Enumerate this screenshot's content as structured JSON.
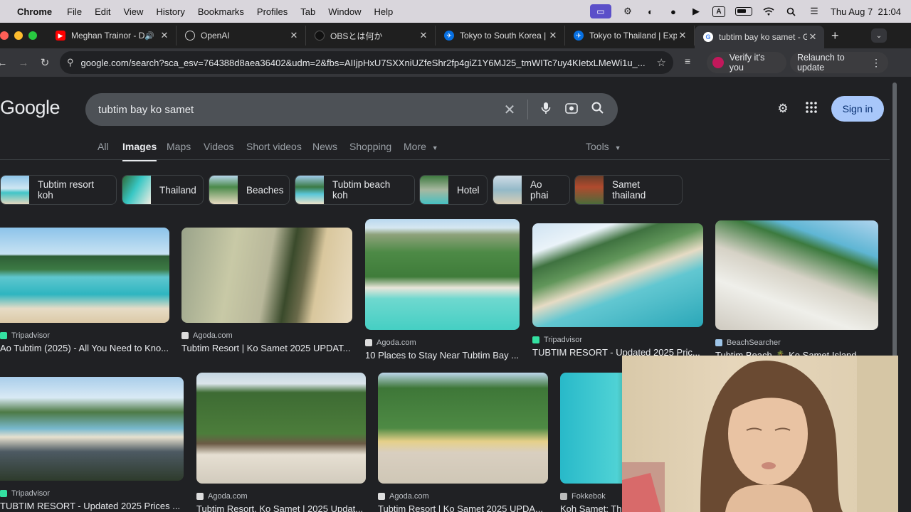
{
  "menubar": {
    "app": "Chrome",
    "items": [
      "File",
      "Edit",
      "View",
      "History",
      "Bookmarks",
      "Profiles",
      "Tab",
      "Window",
      "Help"
    ],
    "datetime": "Thu Aug 7  21:04",
    "input_indicator": "A"
  },
  "tabs": [
    {
      "title": "Meghan Trainor - De",
      "favicon": "youtube-icon",
      "color": "#ff0000",
      "has_speaker": true
    },
    {
      "title": "OpenAI",
      "favicon": "openai-icon",
      "color": "#444444"
    },
    {
      "title": "OBSとは何か",
      "favicon": "chatgpt-icon",
      "color": "#111111"
    },
    {
      "title": "Tokyo to South Korea | E",
      "favicon": "skyscanner-icon",
      "color": "#0770e3"
    },
    {
      "title": "Tokyo to Thailand | Expl",
      "favicon": "skyscanner-icon",
      "color": "#0770e3"
    },
    {
      "title": "tubtim bay ko samet - G",
      "favicon": "google-icon",
      "color": "#ffffff",
      "active": true
    }
  ],
  "toolbar": {
    "url": "google.com/search?sca_esv=764388d8aea36402&udm=2&fbs=AIIjpHxU7SXXniUZfeShr2fp4giZ1Y6MJ25_tmWITc7uy4KIetxLMeWi1u_...",
    "verify": "Verify it's you",
    "relaunch": "Relaunch to update"
  },
  "google": {
    "logo": "Google",
    "query": "tubtim bay ko samet",
    "signin": "Sign in",
    "nav": [
      "All",
      "Images",
      "Maps",
      "Videos",
      "Short videos",
      "News",
      "Shopping",
      "More"
    ],
    "tools": "Tools"
  },
  "chips": [
    "Tubtim resort koh",
    "Thailand",
    "Beaches",
    "Tubtim beach koh",
    "Hotel",
    "Ao phai",
    "Samet thailand"
  ],
  "results_row1": [
    {
      "source": "Tripadvisor",
      "caption": "Ao Tubtim (2025) - All You Need to Kno...",
      "fav": "#34e0a1"
    },
    {
      "source": "Agoda.com",
      "caption": "Tubtim Resort | Ko Samet 2025 UPDAT...",
      "fav": "#dddddd"
    },
    {
      "source": "Agoda.com",
      "caption": "10 Places to Stay Near Tubtim Bay ...",
      "fav": "#dddddd"
    },
    {
      "source": "Tripadvisor",
      "caption": "TUBTIM RESORT - Updated 2025 Pric...",
      "fav": "#34e0a1"
    },
    {
      "source": "BeachSearcher",
      "caption": "Tubtim Beach 🏝️ Ko Samet Island ...",
      "fav": "#9ec5e8"
    }
  ],
  "results_row2": [
    {
      "source": "Tripadvisor",
      "caption": "TUBTIM RESORT - Updated 2025 Prices ...",
      "fav": "#34e0a1"
    },
    {
      "source": "Agoda.com",
      "caption": "Tubtim Resort, Ko Samet | 2025 Updat...",
      "fav": "#dddddd"
    },
    {
      "source": "Agoda.com",
      "caption": "Tubtim Resort | Ko Samet 2025 UPDA...",
      "fav": "#dddddd"
    },
    {
      "source": "Fokkebok",
      "caption": "Koh Samet: Th",
      "fav": "#bbbbbb"
    }
  ]
}
